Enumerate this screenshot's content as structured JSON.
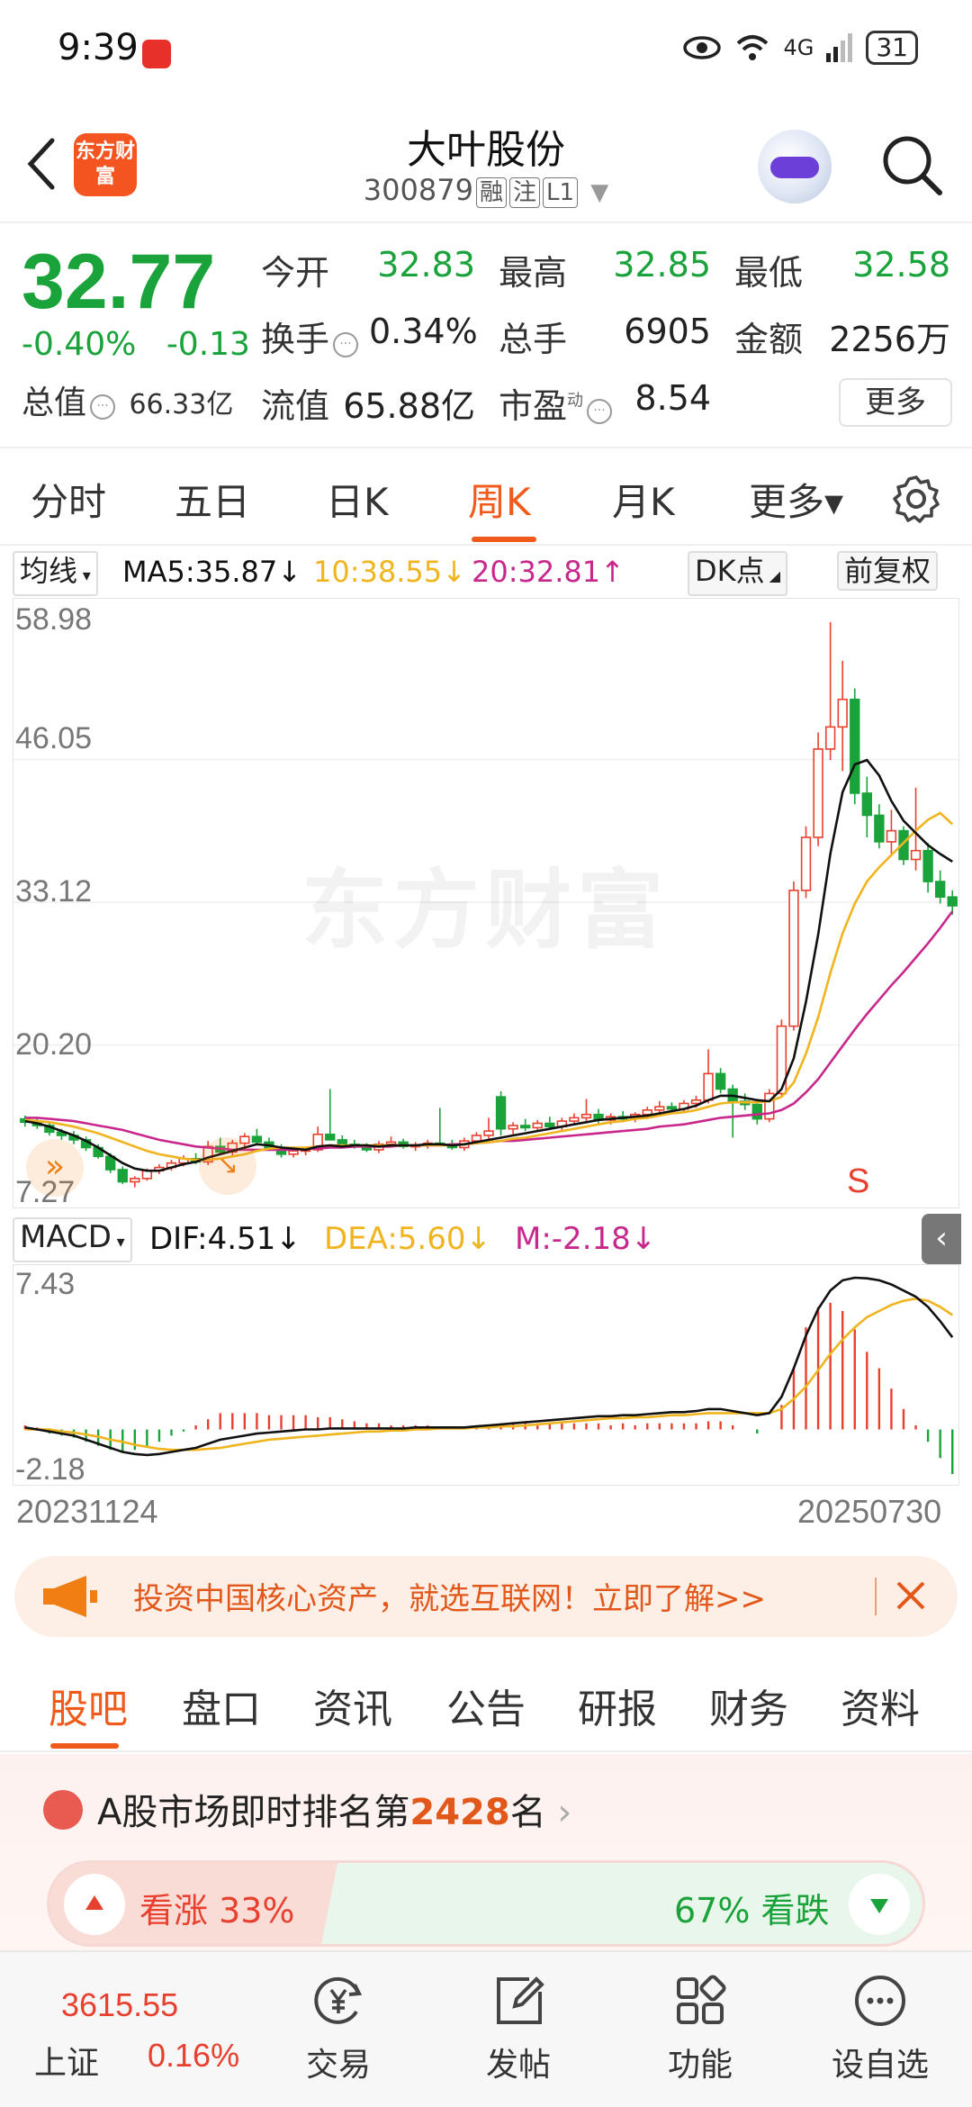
{
  "status_bar": {
    "time": "9:39",
    "network": "4G",
    "battery": "31"
  },
  "header": {
    "logo_text": "东方财富",
    "stock_name": "大叶股份",
    "stock_code": "300879",
    "tags": [
      "融",
      "注",
      "L1"
    ]
  },
  "quote": {
    "price": "32.77",
    "change_pct": "-0.40%",
    "change_amt": "-0.13",
    "market_cap_label": "总值",
    "market_cap": "66.33亿",
    "open_label": "今开",
    "open": "32.83",
    "high_label": "最高",
    "high": "32.85",
    "low_label": "最低",
    "low": "32.58",
    "turnover_label": "换手",
    "turnover": "0.34%",
    "volume_label": "总手",
    "volume": "6905",
    "amount_label": "金额",
    "amount": "2256万",
    "float_cap_label": "流值",
    "float_cap": "65.88亿",
    "pe_label": "市盈",
    "pe_superscript": "动",
    "pe": "8.54",
    "more_label": "更多"
  },
  "period_tabs": [
    {
      "label": "分时"
    },
    {
      "label": "五日"
    },
    {
      "label": "日K"
    },
    {
      "label": "周K",
      "active": true
    },
    {
      "label": "月K"
    },
    {
      "label": "更多▾"
    }
  ],
  "indicators": {
    "ma_selector": "均线",
    "ma5": "MA5:35.87↓",
    "ma10": "10:38.55↓",
    "ma20": "20:32.81↑",
    "dk_button": "DK点",
    "adjust_button": "前复权",
    "macd_selector": "MACD",
    "dif": "DIF:4.51↓",
    "dea": "DEA:5.60↓",
    "m": "M:-2.18↓",
    "s_marker": "S"
  },
  "colors": {
    "up": "#e8402f",
    "down": "#1aa33a",
    "accent": "#f05a1a",
    "ma5": "#111111",
    "ma10": "#f0b41e",
    "ma20": "#c8288c"
  },
  "chart_data": [
    {
      "type": "candlestick",
      "title": "周K",
      "y_ticks": [
        "58.98",
        "46.05",
        "33.12",
        "20.20",
        "7.27"
      ],
      "ylim": [
        7.27,
        58.98
      ],
      "x_range": [
        "20231124",
        "20250730"
      ],
      "watermark": "东方财富",
      "candles": [
        [
          13.5,
          13.8,
          12.8,
          13.2
        ],
        [
          13.2,
          13.6,
          12.6,
          12.9
        ],
        [
          12.9,
          13.2,
          12.0,
          12.3
        ],
        [
          12.3,
          12.6,
          11.6,
          12.0
        ],
        [
          12.0,
          12.4,
          11.2,
          11.6
        ],
        [
          11.6,
          11.9,
          10.6,
          10.9
        ],
        [
          10.9,
          11.2,
          9.9,
          10.1
        ],
        [
          10.1,
          10.4,
          8.6,
          8.9
        ],
        [
          8.9,
          9.2,
          7.6,
          7.8
        ],
        [
          7.8,
          8.3,
          7.3,
          8.1
        ],
        [
          8.1,
          9.0,
          7.9,
          8.8
        ],
        [
          8.8,
          9.4,
          8.5,
          9.1
        ],
        [
          9.1,
          9.8,
          8.8,
          9.5
        ],
        [
          9.5,
          10.2,
          9.2,
          9.9
        ],
        [
          9.9,
          10.4,
          9.4,
          9.6
        ],
        [
          9.6,
          11.5,
          9.3,
          11.0
        ],
        [
          11.0,
          11.8,
          10.2,
          10.5
        ],
        [
          10.5,
          11.6,
          10.2,
          11.3
        ],
        [
          11.3,
          12.2,
          10.8,
          11.9
        ],
        [
          11.9,
          12.6,
          11.1,
          11.4
        ],
        [
          11.4,
          11.8,
          10.6,
          10.9
        ],
        [
          10.9,
          11.2,
          10.0,
          10.3
        ],
        [
          10.3,
          10.8,
          10.0,
          10.6
        ],
        [
          10.6,
          11.0,
          10.2,
          10.7
        ],
        [
          10.7,
          12.8,
          10.5,
          12.1
        ],
        [
          12.1,
          16.2,
          11.8,
          11.6
        ],
        [
          11.6,
          12.0,
          10.9,
          11.2
        ],
        [
          11.2,
          11.6,
          10.8,
          11.0
        ],
        [
          11.0,
          11.3,
          10.5,
          10.7
        ],
        [
          10.7,
          11.5,
          10.4,
          11.2
        ],
        [
          11.2,
          11.9,
          10.9,
          11.4
        ],
        [
          11.4,
          11.7,
          10.8,
          11.0
        ],
        [
          11.0,
          11.4,
          10.6,
          11.1
        ],
        [
          11.1,
          11.6,
          10.8,
          11.3
        ],
        [
          11.3,
          14.5,
          11.0,
          11.2
        ],
        [
          11.2,
          11.6,
          10.7,
          10.9
        ],
        [
          10.9,
          11.8,
          10.6,
          11.5
        ],
        [
          11.5,
          12.3,
          11.2,
          12.0
        ],
        [
          12.0,
          13.6,
          11.7,
          12.4
        ],
        [
          15.5,
          16.0,
          12.0,
          12.6
        ],
        [
          12.6,
          13.2,
          12.1,
          12.9
        ],
        [
          12.9,
          13.5,
          12.4,
          12.7
        ],
        [
          12.7,
          13.4,
          12.3,
          13.1
        ],
        [
          13.1,
          13.7,
          12.6,
          12.8
        ],
        [
          12.8,
          13.6,
          12.5,
          13.3
        ],
        [
          13.3,
          14.0,
          12.9,
          13.6
        ],
        [
          13.6,
          15.3,
          13.2,
          13.9
        ],
        [
          13.9,
          14.4,
          13.1,
          13.4
        ],
        [
          13.4,
          14.0,
          13.0,
          13.7
        ],
        [
          13.7,
          14.2,
          13.2,
          13.5
        ],
        [
          13.5,
          14.1,
          13.2,
          13.9
        ],
        [
          13.9,
          14.6,
          13.5,
          14.3
        ],
        [
          14.3,
          15.1,
          13.9,
          14.6
        ],
        [
          14.6,
          15.0,
          14.1,
          14.4
        ],
        [
          14.4,
          15.2,
          14.0,
          14.9
        ],
        [
          14.9,
          15.6,
          14.5,
          15.2
        ],
        [
          15.2,
          19.8,
          14.9,
          17.6
        ],
        [
          17.6,
          18.1,
          15.8,
          16.2
        ],
        [
          16.2,
          16.6,
          11.8,
          15.1
        ],
        [
          15.1,
          15.8,
          14.3,
          14.8
        ],
        [
          14.8,
          15.3,
          13.0,
          13.5
        ],
        [
          13.5,
          16.2,
          13.2,
          15.8
        ],
        [
          15.8,
          22.5,
          15.5,
          21.9
        ],
        [
          21.9,
          35.0,
          21.5,
          34.2
        ],
        [
          34.2,
          40.0,
          33.5,
          39.0
        ],
        [
          39.0,
          48.5,
          38.2,
          47.0
        ],
        [
          47.0,
          58.5,
          46.0,
          49.0
        ],
        [
          49.0,
          55.0,
          45.0,
          51.5
        ],
        [
          51.5,
          52.5,
          42.0,
          43.0
        ],
        [
          43.0,
          44.5,
          39.0,
          41.0
        ],
        [
          41.0,
          42.0,
          38.0,
          38.6
        ],
        [
          38.6,
          41.5,
          37.5,
          39.6
        ],
        [
          39.6,
          40.0,
          36.5,
          37.0
        ],
        [
          37.0,
          43.5,
          36.0,
          37.8
        ],
        [
          37.8,
          38.5,
          34.0,
          35.0
        ],
        [
          35.0,
          36.0,
          33.0,
          33.6
        ],
        [
          33.6,
          34.2,
          32.0,
          32.8
        ]
      ],
      "ma5": [
        13.3,
        13.1,
        12.8,
        12.4,
        12.0,
        11.5,
        10.9,
        10.2,
        9.5,
        9.0,
        8.8,
        8.8,
        9.1,
        9.4,
        9.6,
        10.0,
        10.3,
        10.6,
        10.9,
        11.2,
        11.1,
        10.9,
        10.8,
        10.7,
        11.0,
        11.1,
        11.0,
        11.1,
        11.1,
        11.0,
        11.1,
        11.1,
        11.1,
        11.2,
        11.2,
        11.1,
        11.2,
        11.4,
        11.6,
        11.8,
        12.0,
        12.2,
        12.4,
        12.6,
        12.8,
        13.0,
        13.2,
        13.4,
        13.5,
        13.6,
        13.7,
        13.8,
        14.0,
        14.2,
        14.4,
        14.7,
        15.2,
        15.6,
        15.6,
        15.4,
        15.2,
        15.1,
        16.2,
        19.0,
        24.1,
        30.2,
        37.5,
        43.1,
        45.6,
        46.0,
        44.6,
        42.3,
        40.5,
        39.4,
        38.3,
        37.5,
        36.8
      ],
      "ma10": [
        13.4,
        13.3,
        13.2,
        13.0,
        12.8,
        12.5,
        12.2,
        11.8,
        11.4,
        11.0,
        10.6,
        10.3,
        10.1,
        9.9,
        9.8,
        9.8,
        9.9,
        10.1,
        10.3,
        10.6,
        10.8,
        10.9,
        10.9,
        10.9,
        11.0,
        11.1,
        11.1,
        11.1,
        11.1,
        11.1,
        11.1,
        11.1,
        11.1,
        11.1,
        11.1,
        11.1,
        11.2,
        11.3,
        11.4,
        11.5,
        11.7,
        11.8,
        12.0,
        12.2,
        12.4,
        12.6,
        12.8,
        13.0,
        13.2,
        13.3,
        13.5,
        13.6,
        13.8,
        14.0,
        14.1,
        14.3,
        14.6,
        14.9,
        15.0,
        15.0,
        15.0,
        15.1,
        15.5,
        16.8,
        19.4,
        22.7,
        26.7,
        30.3,
        33.0,
        35.0,
        36.3,
        37.4,
        38.5,
        39.6,
        40.6,
        41.2,
        40.2
      ],
      "ma20": [
        13.6,
        13.6,
        13.5,
        13.4,
        13.3,
        13.1,
        12.9,
        12.7,
        12.5,
        12.2,
        11.9,
        11.6,
        11.4,
        11.2,
        11.0,
        10.9,
        10.8,
        10.7,
        10.7,
        10.7,
        10.7,
        10.7,
        10.7,
        10.8,
        10.8,
        10.9,
        10.9,
        11.0,
        11.0,
        11.0,
        11.0,
        11.1,
        11.1,
        11.1,
        11.1,
        11.2,
        11.2,
        11.3,
        11.4,
        11.5,
        11.5,
        11.6,
        11.7,
        11.8,
        11.9,
        12.0,
        12.1,
        12.2,
        12.3,
        12.4,
        12.5,
        12.6,
        12.8,
        12.9,
        13.0,
        13.2,
        13.4,
        13.6,
        13.7,
        13.8,
        13.9,
        14.0,
        14.3,
        14.9,
        15.9,
        17.1,
        18.6,
        20.1,
        21.6,
        23.0,
        24.3,
        25.6,
        26.8,
        28.1,
        29.4,
        30.8,
        32.3
      ]
    },
    {
      "type": "macd",
      "y_ticks": [
        "7.43",
        "-2.18"
      ],
      "ylim": [
        -2.18,
        7.43
      ],
      "dif": [
        0.1,
        0.0,
        -0.1,
        -0.2,
        -0.3,
        -0.5,
        -0.7,
        -0.9,
        -1.1,
        -1.2,
        -1.25,
        -1.2,
        -1.1,
        -1.0,
        -0.9,
        -0.7,
        -0.5,
        -0.4,
        -0.3,
        -0.2,
        -0.15,
        -0.1,
        -0.05,
        0.0,
        0.0,
        0.05,
        0.05,
        0.05,
        0.05,
        0.05,
        0.05,
        0.05,
        0.1,
        0.1,
        0.1,
        0.1,
        0.1,
        0.15,
        0.2,
        0.25,
        0.3,
        0.35,
        0.4,
        0.45,
        0.5,
        0.55,
        0.6,
        0.65,
        0.65,
        0.7,
        0.7,
        0.75,
        0.8,
        0.85,
        0.85,
        0.9,
        1.0,
        1.0,
        0.9,
        0.8,
        0.7,
        0.8,
        1.6,
        3.0,
        4.6,
        5.9,
        6.8,
        7.3,
        7.43,
        7.4,
        7.3,
        7.1,
        6.8,
        6.5,
        6.0,
        5.3,
        4.51
      ],
      "dea": [
        0.0,
        0.0,
        0.0,
        -0.1,
        -0.15,
        -0.25,
        -0.35,
        -0.5,
        -0.6,
        -0.75,
        -0.85,
        -0.95,
        -1.0,
        -1.0,
        -1.0,
        -0.95,
        -0.9,
        -0.8,
        -0.7,
        -0.6,
        -0.5,
        -0.45,
        -0.4,
        -0.35,
        -0.3,
        -0.25,
        -0.2,
        -0.15,
        -0.1,
        -0.1,
        -0.05,
        -0.05,
        0.0,
        0.0,
        0.05,
        0.05,
        0.05,
        0.1,
        0.1,
        0.15,
        0.15,
        0.2,
        0.25,
        0.3,
        0.35,
        0.4,
        0.45,
        0.5,
        0.55,
        0.55,
        0.6,
        0.6,
        0.65,
        0.7,
        0.7,
        0.75,
        0.8,
        0.8,
        0.8,
        0.8,
        0.8,
        0.8,
        1.0,
        1.5,
        2.1,
        2.9,
        3.7,
        4.4,
        5.0,
        5.5,
        5.8,
        6.1,
        6.3,
        6.4,
        6.3,
        6.0,
        5.6
      ],
      "m": [
        0.2,
        0.1,
        -0.2,
        -0.3,
        -0.4,
        -0.6,
        -0.8,
        -1.0,
        -1.1,
        -1.0,
        -0.9,
        -0.6,
        -0.3,
        -0.1,
        0.2,
        0.5,
        0.8,
        0.8,
        0.8,
        0.8,
        0.7,
        0.7,
        0.7,
        0.7,
        0.6,
        0.6,
        0.5,
        0.4,
        0.3,
        0.3,
        0.2,
        0.2,
        0.2,
        0.2,
        0.1,
        0.1,
        0.1,
        0.1,
        0.2,
        0.2,
        0.3,
        0.3,
        0.3,
        0.3,
        0.3,
        0.3,
        0.3,
        0.3,
        0.2,
        0.3,
        0.2,
        0.3,
        0.3,
        0.3,
        0.3,
        0.3,
        0.4,
        0.4,
        0.2,
        0.0,
        -0.2,
        0.0,
        1.2,
        3.0,
        5.0,
        6.0,
        6.2,
        5.8,
        4.9,
        3.8,
        3.0,
        2.0,
        1.0,
        0.2,
        -0.6,
        -1.4,
        -2.18
      ]
    }
  ],
  "ad": {
    "text": "投资中国核心资产，就选互联网！立即了解>>"
  },
  "content_tabs": [
    {
      "label": "股吧",
      "active": true
    },
    {
      "label": "盘口"
    },
    {
      "label": "资讯"
    },
    {
      "label": "公告"
    },
    {
      "label": "研报"
    },
    {
      "label": "财务"
    },
    {
      "label": "资料"
    }
  ],
  "ranking": {
    "prefix": "A股市场即时排名第",
    "rank": "2428",
    "suffix": "名"
  },
  "vote": {
    "bull": "看涨 33%",
    "bear": "67% 看跌",
    "bull_fraction": 0.33
  },
  "bottom_nav": {
    "index_value": "3615.55",
    "index_name": "上证",
    "index_change": "0.16%",
    "items": [
      {
        "label": "交易",
        "icon": "trade-yen-icon"
      },
      {
        "label": "发帖",
        "icon": "edit-post-icon"
      },
      {
        "label": "功能",
        "icon": "grid-icon"
      },
      {
        "label": "设自选",
        "icon": "more-dots-icon"
      }
    ]
  }
}
